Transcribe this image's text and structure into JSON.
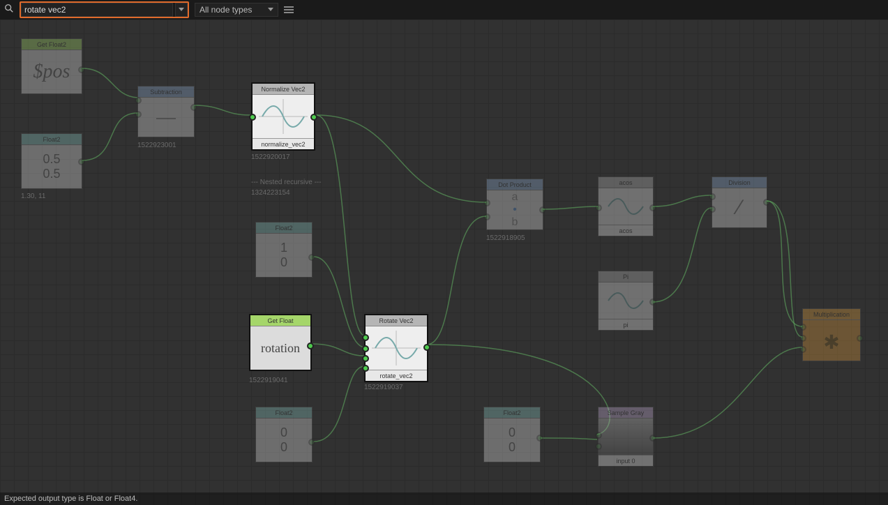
{
  "toolbar": {
    "search_value": "rotate vec2",
    "type_filter": "All node types"
  },
  "status_bar": "Expected output type is Float or Float4.",
  "nodes": {
    "getFloat2": {
      "title": "Get Float2",
      "body": "$pos",
      "meta": ""
    },
    "float2a": {
      "title": "Float2",
      "val1": "0.5",
      "val2": "0.5",
      "meta": "1.30, 11"
    },
    "subtract": {
      "title": "Subtraction",
      "meta": "1522923001"
    },
    "normalize": {
      "title": "Normalize Vec2",
      "footer": "normalize_vec2",
      "meta": "1522920017"
    },
    "nested": "--- Nested recursive ---",
    "nested_id": "1324223154",
    "float2b": {
      "title": "Float2",
      "val1": "1",
      "val2": "0"
    },
    "getFloat": {
      "title": "Get Float",
      "body": "rotation",
      "meta": "1522919041"
    },
    "rotate": {
      "title": "Rotate Vec2",
      "footer": "rotate_vec2",
      "meta": "1522919037"
    },
    "float2c": {
      "title": "Float2",
      "val1": "0",
      "val2": "0"
    },
    "dotprod": {
      "title": "Dot Product",
      "meta": "1522918905"
    },
    "float2d": {
      "title": "Float2",
      "val1": "0",
      "val2": "0"
    },
    "acos": {
      "title": "acos",
      "footer": "acos"
    },
    "pi": {
      "title": "Pi",
      "footer": "pi"
    },
    "sampleGray": {
      "title": "Sample Gray",
      "footer": "input 0"
    },
    "division": {
      "title": "Division"
    },
    "mult": {
      "title": "Multiplication"
    }
  }
}
